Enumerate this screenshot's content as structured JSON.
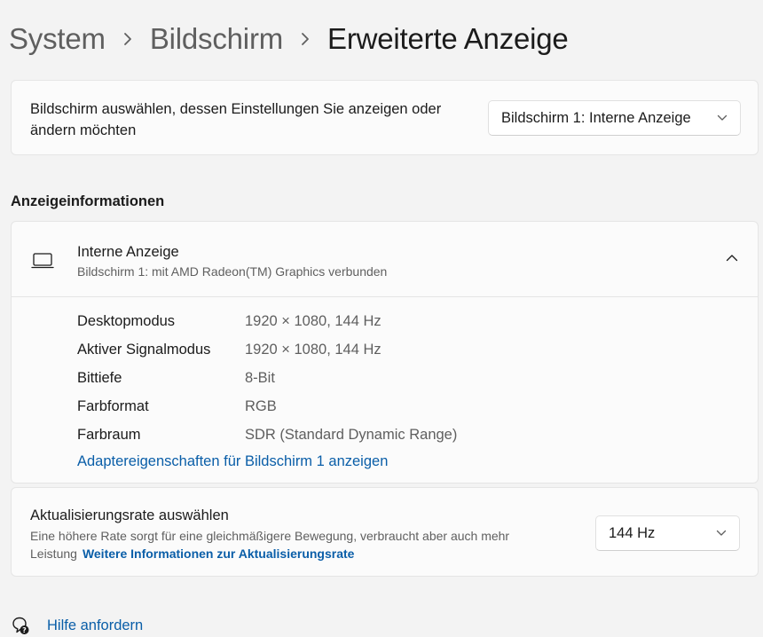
{
  "breadcrumb": {
    "items": [
      "System",
      "Bildschirm",
      "Erweiterte Anzeige"
    ]
  },
  "display_select": {
    "description": "Bildschirm auswählen, dessen Einstellungen Sie anzeigen oder ändern möchten",
    "selected": "Bildschirm 1: Interne Anzeige"
  },
  "display_info": {
    "section_title": "Anzeigeinformationen",
    "title": "Interne Anzeige",
    "subtitle": "Bildschirm 1: mit AMD Radeon(TM) Graphics verbunden",
    "properties": [
      {
        "label": "Desktopmodus",
        "value": "1920 × 1080, 144 Hz"
      },
      {
        "label": "Aktiver Signalmodus",
        "value": "1920 × 1080, 144 Hz"
      },
      {
        "label": "Bittiefe",
        "value": "8-Bit"
      },
      {
        "label": "Farbformat",
        "value": "RGB"
      },
      {
        "label": "Farbraum",
        "value": "SDR (Standard Dynamic Range)"
      }
    ],
    "adapter_link": "Adaptereigenschaften für Bildschirm 1 anzeigen"
  },
  "refresh_rate": {
    "title": "Aktualisierungsrate auswählen",
    "description": "Eine höhere Rate sorgt für eine gleichmäßigere Bewegung, verbraucht aber auch mehr Leistung",
    "link": "Weitere Informationen zur Aktualisierungsrate",
    "selected": "144 Hz"
  },
  "help": {
    "label": "Hilfe anfordern"
  },
  "colors": {
    "background": "#f3f3f3",
    "card": "#fbfbfb",
    "accent_link": "#0a5ea8",
    "secondary_text": "#5f5f5f"
  },
  "icons": [
    "chevron-right-icon",
    "chevron-down-icon",
    "laptop-icon",
    "chevron-up-icon",
    "help-icon"
  ]
}
